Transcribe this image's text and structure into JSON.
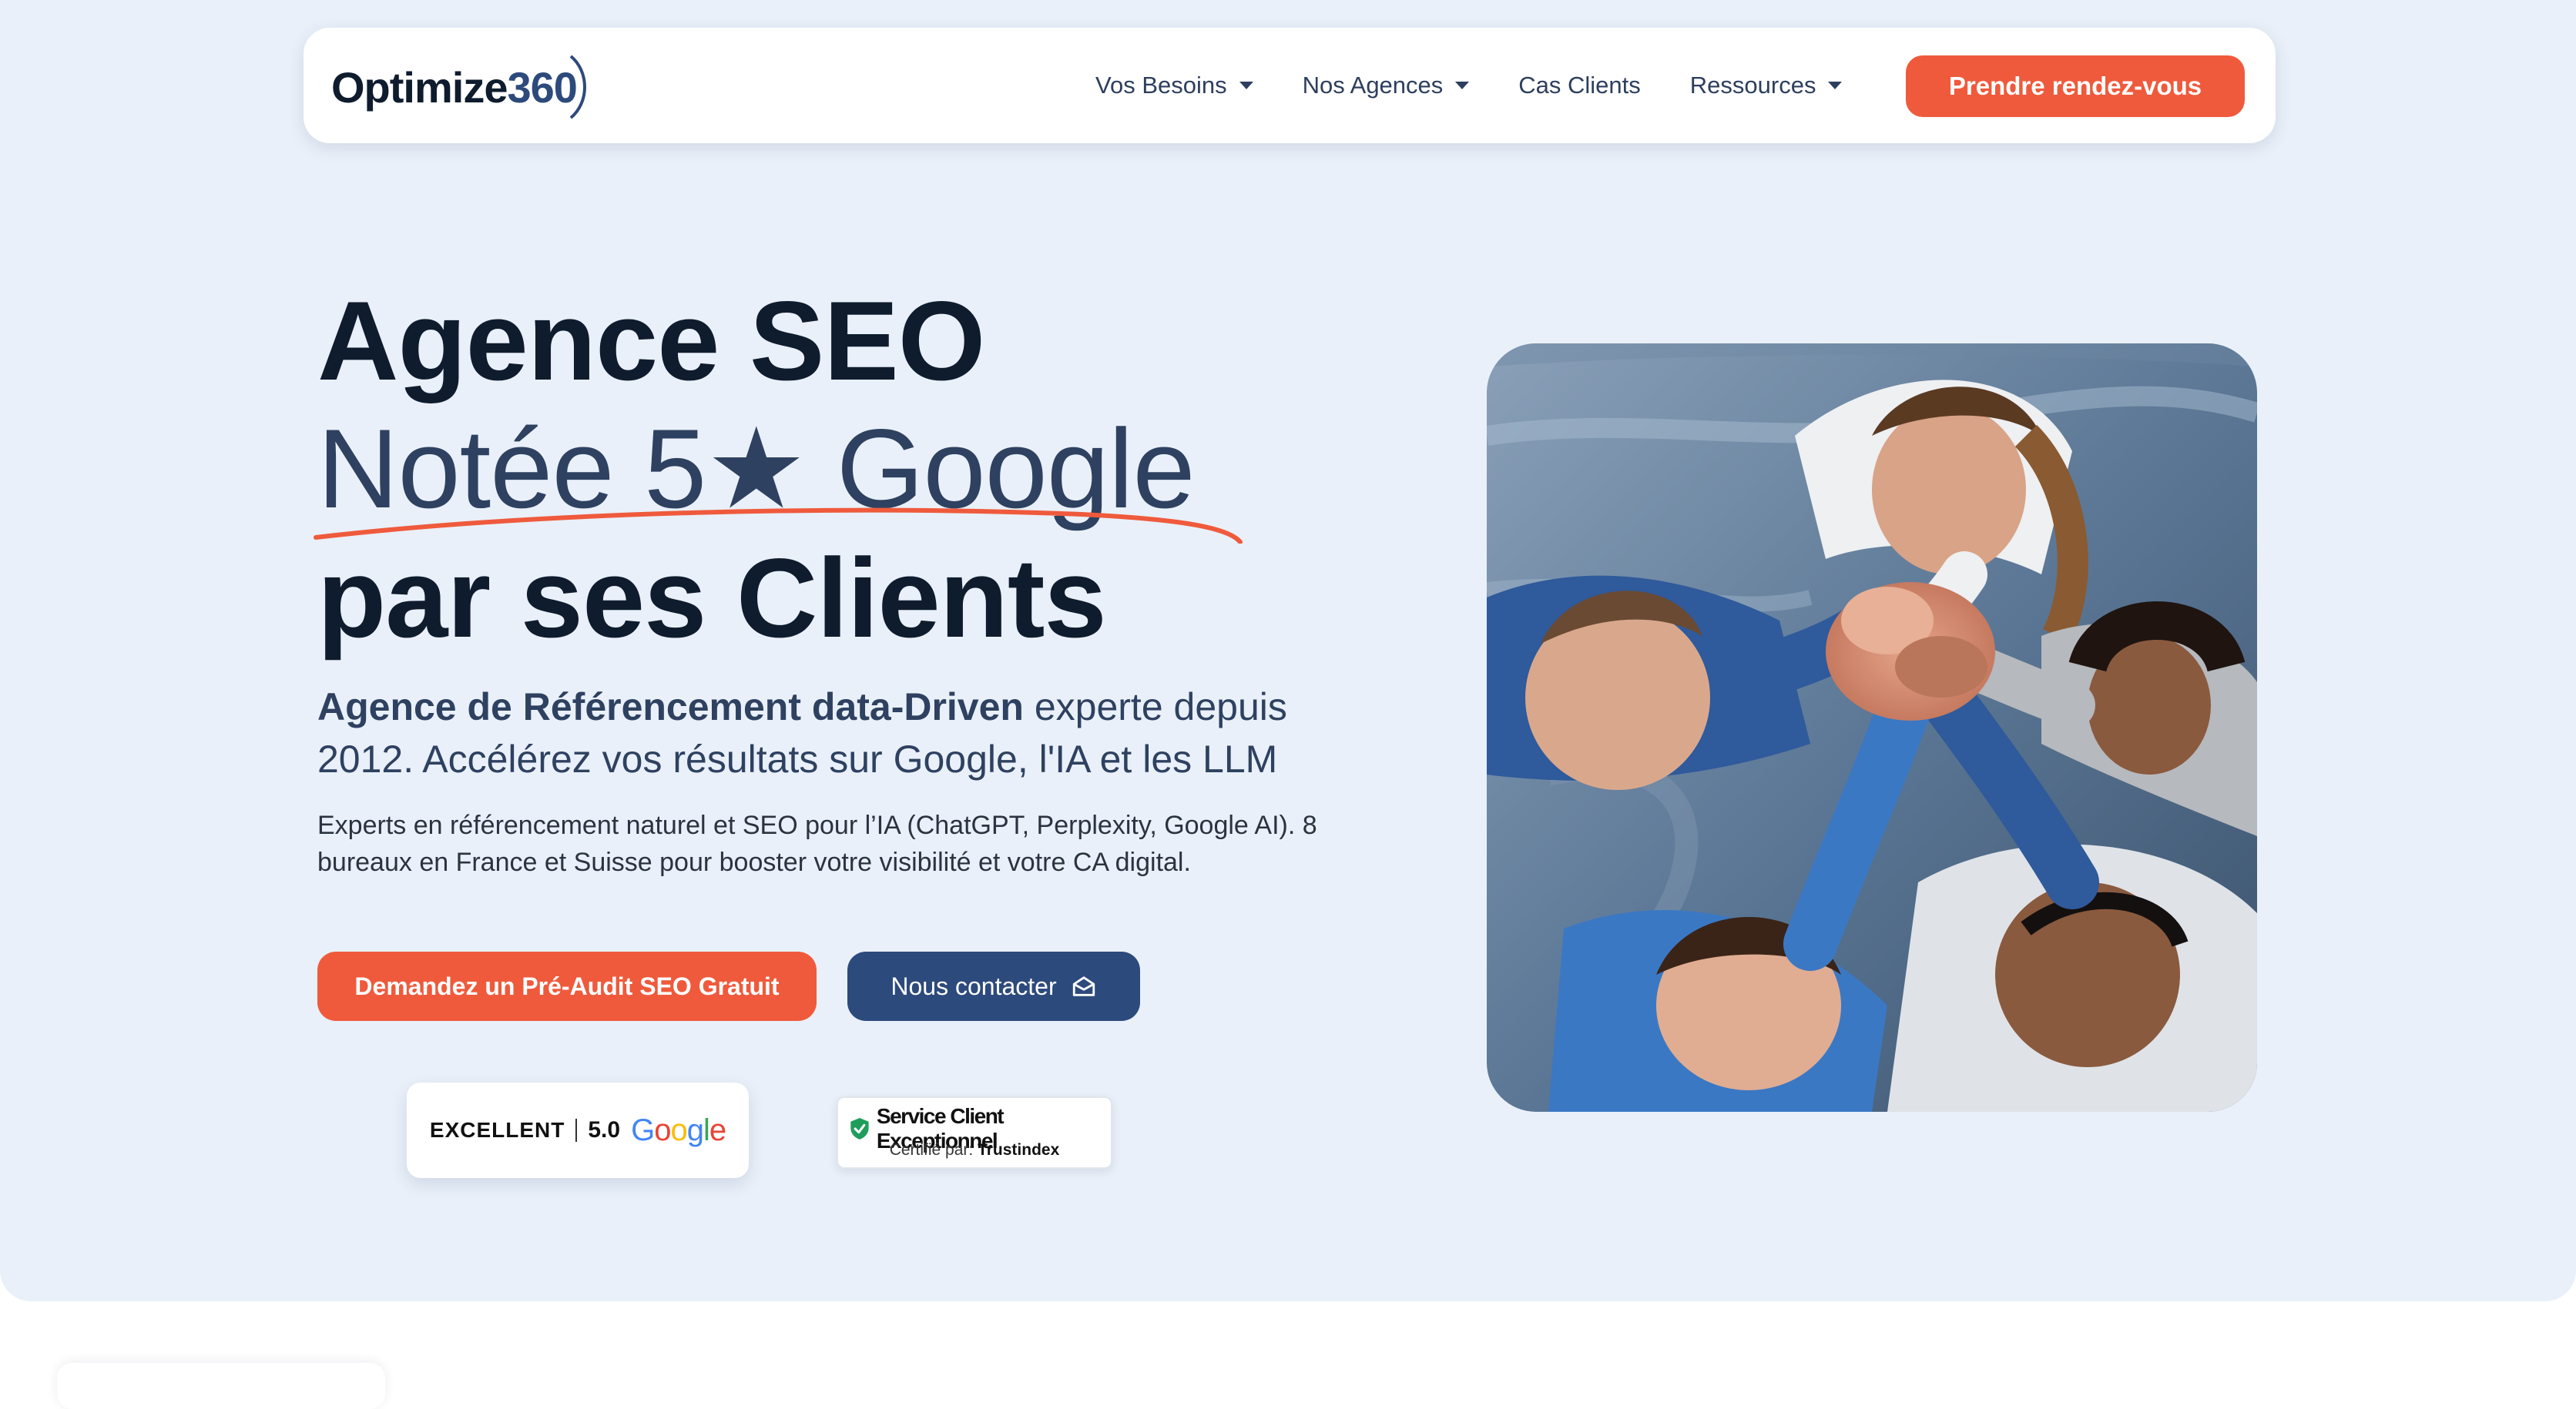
{
  "brand": {
    "name_part1": "Optimize",
    "name_part2": "360"
  },
  "nav": {
    "items": [
      {
        "label": "Vos Besoins",
        "has_dropdown": true
      },
      {
        "label": "Nos Agences",
        "has_dropdown": true
      },
      {
        "label": "Cas Clients",
        "has_dropdown": false
      },
      {
        "label": "Ressources",
        "has_dropdown": true
      }
    ],
    "cta_label": "Prendre rendez-vous"
  },
  "hero": {
    "title_line1": "Agence SEO",
    "title_line2": "Notée 5★ Google",
    "title_line3": "par ses Clients",
    "subtitle_bold": "Agence de Référencement data-Driven",
    "subtitle_rest": " experte depuis 2012. Accélérez vos résultats sur Google, l'IA et les LLM",
    "description": "Experts en référencement naturel et SEO pour l’IA (ChatGPT, Perplexity, Google AI). 8 bureaux en France et Suisse pour booster votre visibilité et votre CA digital.",
    "primary_button": "Demandez un Pré-Audit SEO Gratuit",
    "secondary_button": "Nous contacter"
  },
  "badges": {
    "google": {
      "rating_word": "EXCELLENT",
      "score": "5.0",
      "brand": "Google"
    },
    "trustindex": {
      "title": "Service Client Exceptionnel",
      "certified_prefix": "Certifié par: ",
      "certifier": "Trustindex"
    }
  },
  "colors": {
    "accent": "#ef5a3c",
    "navy": "#2d4a7c",
    "hero_bg": "#e9f0f9",
    "text_dark": "#0f1c2e"
  },
  "icons": {
    "nav_caret": "chevron-down-icon",
    "contact": "envelope-open-icon",
    "trust_check": "shield-check-icon"
  }
}
